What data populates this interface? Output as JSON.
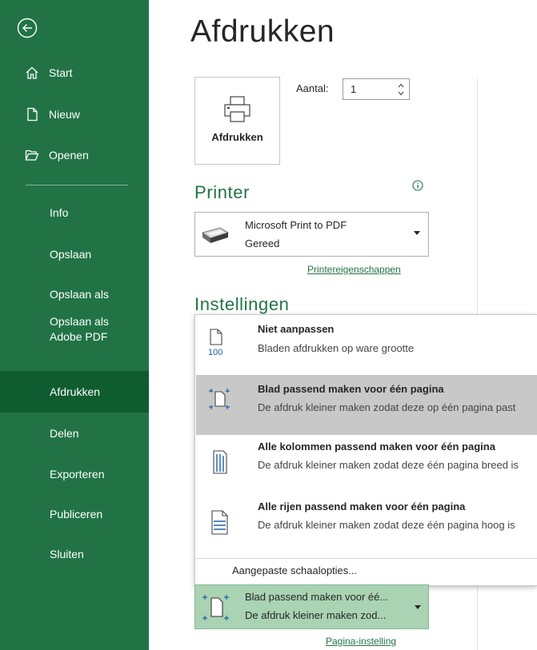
{
  "sidebar": {
    "top_items": [
      {
        "label": "Start",
        "icon": "home-icon"
      },
      {
        "label": "Nieuw",
        "icon": "new-document-icon"
      },
      {
        "label": "Openen",
        "icon": "folder-open-icon"
      }
    ],
    "items": [
      {
        "label": "Info"
      },
      {
        "label": "Opslaan"
      },
      {
        "label": "Opslaan als"
      },
      {
        "label": "Opslaan als\nAdobe PDF"
      },
      {
        "label": "Afdrukken",
        "active": true
      },
      {
        "label": "Delen"
      },
      {
        "label": "Exporteren"
      },
      {
        "label": "Publiceren"
      },
      {
        "label": "Sluiten"
      }
    ]
  },
  "main": {
    "title": "Afdrukken",
    "print_button_label": "Afdrukken",
    "copies_label": "Aantal:",
    "copies_value": "1",
    "printer_heading": "Printer",
    "printer_name": "Microsoft Print to PDF",
    "printer_status": "Gereed",
    "printer_properties_link": "Printereigenschappen",
    "settings_heading": "Instellingen",
    "page_setup_link": "Pagina-instelling"
  },
  "scaling_menu": {
    "options": [
      {
        "title": "Niet aanpassen",
        "desc": "Bladen afdrukken op ware grootte",
        "icon": "no-scaling-icon",
        "selected": false
      },
      {
        "title": "Blad passend maken voor één pagina",
        "desc": "De afdruk kleiner maken zodat deze op één pagina past",
        "icon": "fit-sheet-icon",
        "selected": true
      },
      {
        "title": "Alle kolommen passend maken voor één pagina",
        "desc": "De afdruk kleiner maken zodat deze één pagina breed is",
        "icon": "fit-columns-icon",
        "selected": false
      },
      {
        "title": "Alle rijen passend maken voor één pagina",
        "desc": "De afdruk kleiner maken zodat deze één pagina hoog is",
        "icon": "fit-rows-icon",
        "selected": false
      }
    ],
    "custom_label": "Aangepaste schaalopties...",
    "no_scaling_icon_text": "100"
  },
  "scaling_selector": {
    "line1": "Blad passend maken voor éé...",
    "line2": "De afdruk kleiner maken zod..."
  },
  "colors": {
    "accent": "#217346",
    "active_nav": "#0e5c2f",
    "selected_option": "#c8c8c8",
    "selector_bg": "#a9d3b2"
  }
}
